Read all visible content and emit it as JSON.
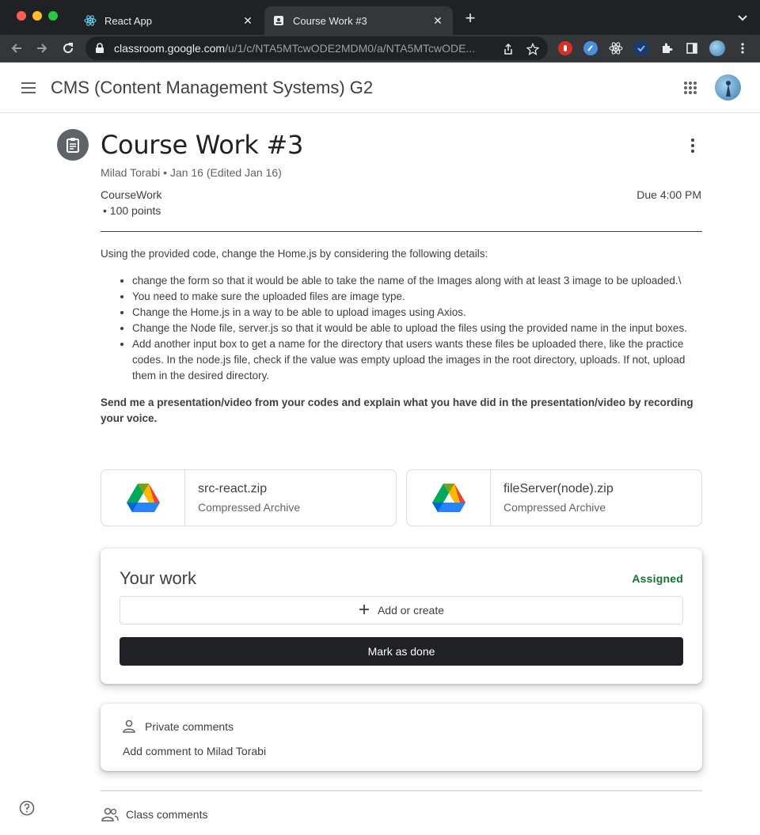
{
  "browser": {
    "tabs": [
      {
        "title": "React App",
        "icon": "react-icon",
        "active": false
      },
      {
        "title": "Course Work #3",
        "icon": "classroom-assignment-icon",
        "active": true
      }
    ],
    "url_host": "classroom.google.com",
    "url_path": "/u/1/c/NTA5MTcwODE2MDM0/a/NTA5MTcwODE..."
  },
  "header": {
    "class_title": "CMS (Content Management Systems) G2"
  },
  "assignment": {
    "title": "Course Work #3",
    "meta": "Milad Torabi • Jan 16 (Edited Jan 16)",
    "topic": "CourseWork",
    "points": "• 100 points",
    "due": "Due 4:00 PM",
    "intro": "Using the provided code, change the Home.js by considering the following details:",
    "bullets": [
      "change the form so that it would be able to take the name of the Images along with at least 3 image to be uploaded.\\",
      "You need to make sure the uploaded files are image type.",
      "Change the Home.js in a way to be able to upload images using Axios.",
      "Change the Node file, server.js so that it would be able to upload the files using the provided name in the input boxes.",
      "Add another input box to get a name for the directory that users wants these files be uploaded there, like the practice codes. In the node.js file, check if the value was empty upload the images in the root directory, uploads. If not, upload them in the desired directory."
    ],
    "closing": "Send me a presentation/video from your codes and explain what you have did in the presentation/video by recording your voice.",
    "attachments": [
      {
        "name": "src-react.zip",
        "type": "Compressed Archive",
        "icon": "google-drive-icon"
      },
      {
        "name": "fileServer(node).zip",
        "type": "Compressed Archive",
        "icon": "google-drive-icon"
      }
    ]
  },
  "your_work": {
    "title": "Your work",
    "status": "Assigned",
    "status_color": "#137333",
    "add_label": "Add or create",
    "done_label": "Mark as done"
  },
  "private_comments": {
    "title": "Private comments",
    "add_label": "Add comment to Milad Torabi"
  },
  "class_comments": {
    "title": "Class comments"
  }
}
